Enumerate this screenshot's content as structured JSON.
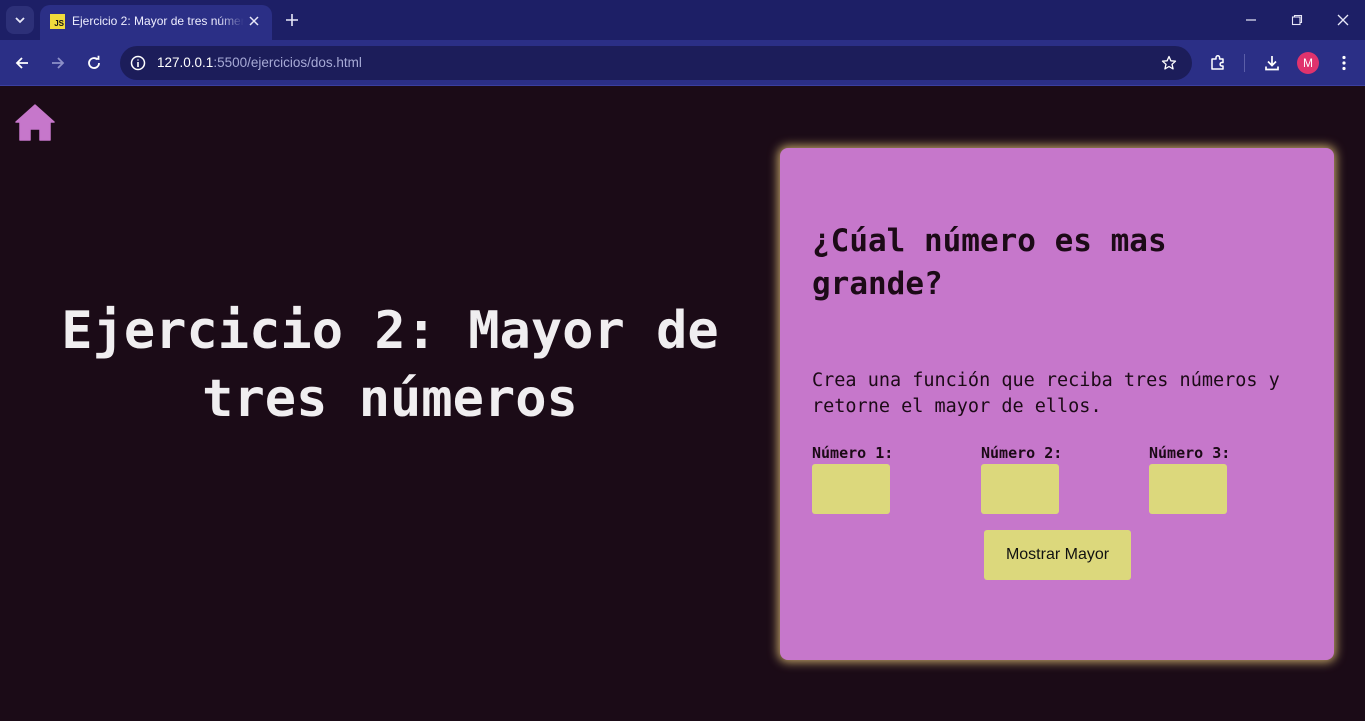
{
  "browser": {
    "tab": {
      "favicon_text": "JS",
      "title": "Ejercicio 2: Mayor de tres números"
    },
    "address_bar": {
      "host": "127.0.0.1",
      "rest": ":5500/ejercicios/dos.html"
    },
    "profile_initial": "M"
  },
  "page": {
    "main_title": "Ejercicio 2: Mayor de tres números",
    "card": {
      "title": "¿Cúal número es mas grande?",
      "description": "Crea una función que reciba tres números y retorne el mayor de ellos.",
      "fields": [
        {
          "label": "Número 1:",
          "value": ""
        },
        {
          "label": "Número 2:",
          "value": ""
        },
        {
          "label": "Número 3:",
          "value": ""
        }
      ],
      "button_label": "Mostrar Mayor"
    }
  },
  "colors": {
    "page_background": "#1b0b17",
    "card_background": "#c677cb",
    "input_background": "#dcd87c",
    "home_icon": "#c677cb",
    "browser_frame": "#1d1f66"
  }
}
